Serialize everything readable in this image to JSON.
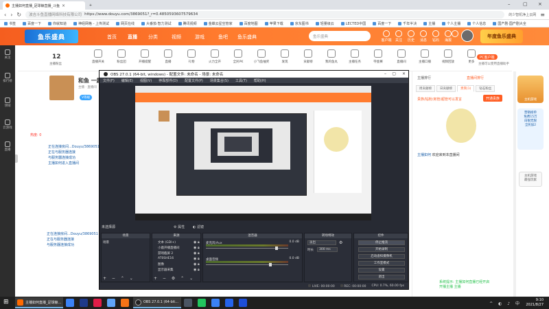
{
  "browser": {
    "tabs": [
      {
        "title": "主播如何直播_足球鲸直播_斗鱼",
        "active": true
      },
      {
        "title": "+",
        "active": false
      }
    ],
    "url": "https://www.douyu.com/3869051?_r=0.4850593607579634",
    "url_label": "波吉斗鱼直播网络科技有限公司",
    "address_right": "的少智机净上云网",
    "bookmarks": [
      "书签",
      "百度一下",
      "你就知道",
      "神经网格 - 上传测试",
      "网页在线",
      "大番茄·智力测试",
      "腾讯视频",
      "金蝶云星空管家",
      "百度地图",
      "苹果下载",
      "京东图书",
      "轻量级云",
      "LECTED中国",
      "百度一下",
      "千年半决",
      "主播",
      "个人主播",
      "个人信息",
      "国产剧·国产剧大全"
    ]
  },
  "douyu": {
    "logo": "鱼乐盛典",
    "nav": [
      "首页",
      "直播",
      "分类",
      "视频",
      "游戏",
      "鱼吧",
      "鱼乐盛典"
    ],
    "active_nav": "直播",
    "search_placeholder": "鱼乐盛典",
    "header_icons": [
      "客户端",
      "关注",
      "历史",
      "消息",
      "钻石",
      "海报",
      "创作中心"
    ],
    "banner_badge": "年度鱼乐盛典"
  },
  "left_sidebar": [
    "关注",
    "排行榜",
    "领域",
    "云游戏",
    "直播"
  ],
  "room_tools": {
    "fans_count": "12",
    "fans_label": "主播粉丝",
    "items": [
      "直播开关",
      "粉丝团",
      "开播提醒",
      "直播",
      "礼物",
      "火力全开",
      "全民PK",
      "小飞鱼抽奖",
      "发现",
      "贡献榜",
      "我的鱼丸",
      "主播任务",
      "夺金赛",
      "直播间",
      "主播口播",
      "视频回放",
      "更多"
    ],
    "pc_client": "PC客户端",
    "pc_client_sub": "主播可以使用直播助手"
  },
  "streamer": {
    "name": "和鱼 一起",
    "tag": "主播 · 直播间",
    "level": "V等级"
  },
  "left_chat": {
    "heat": "热度: 0",
    "lines": [
      "正在连接房间...Douyu/3869051",
      "正在与服务器连接",
      "与服务器连接成功",
      "主播如何进入直播间"
    ],
    "lines2": [
      "正在连接房间...Douyu/3869051",
      "正在与服务器连接",
      "与服务器连接成功"
    ]
  },
  "right_panel": {
    "top_label": "主播排行",
    "top_rank": "直播间排行",
    "tabs": [
      "周贡献榜",
      "日贡献榜",
      "贵宾(1)",
      "钻石粉丝"
    ],
    "active_tab": "贵宾(1)",
    "notice": "贵族/钻粉/房管/超管可以发言",
    "join_button": "开通贵族",
    "welcome_user": "主播如何",
    "welcome_text": "欢迎来到本直播间",
    "green_lines": [
      "系统提示: 主播如何直播已经开启",
      "开播主播 主播"
    ]
  },
  "promo": {
    "p1": "主机游戏",
    "p2": [
      "营销榜单",
      "免费15万",
      "白银无限",
      "全民加2"
    ],
    "p3": [
      "主机游戏",
      "最强玩家"
    ]
  },
  "obs": {
    "title": "OBS 27.0.1 (64-bit, windows) - 配置文件: 未命名 - 场景: 未命名",
    "menu": [
      "文件(F)",
      "编辑(E)",
      "视图(V)",
      "停靠部件(D)",
      "配置文件(P)",
      "场景集合(S)",
      "工具(T)",
      "帮助(H)"
    ],
    "no_scene": "未选择源",
    "properties": "属性",
    "filters": "滤镜",
    "docks": {
      "scenes": "场景",
      "sources": "来源",
      "mixer": "混音器",
      "transitions": "转场特效",
      "controls": "控件"
    },
    "scene_items": [
      "场景"
    ],
    "sources": [
      "文本 (GDI+)",
      "小鹿开播直播间",
      "游戏截屏 2",
      "AT0SHE16",
      "图像",
      "显示器采集"
    ],
    "mixer": [
      {
        "name": "麦克风/Aux",
        "db": "0.0 dB",
        "level": 0.86
      },
      {
        "name": "桌面音频",
        "db": "0.0 dB",
        "level": 0.78
      }
    ],
    "transition": "淡出",
    "duration_label": "时长",
    "duration": "300 ms",
    "controls": [
      "停止推流",
      "开始录制",
      "启动虚拟摄像机",
      "工作室模式",
      "设置",
      "退出"
    ],
    "status": {
      "live": "LIVE: 00:00:00",
      "rec": "REC: 00:00:00",
      "cpu": "CPU: 0.7%, 60.00 fps"
    }
  },
  "taskbar": {
    "tasks": [
      "主播如何直播_足球鲸...",
      "OBS 27.0.1 (64-bit..."
    ],
    "time": "9:10",
    "date": "2021/8/27"
  }
}
